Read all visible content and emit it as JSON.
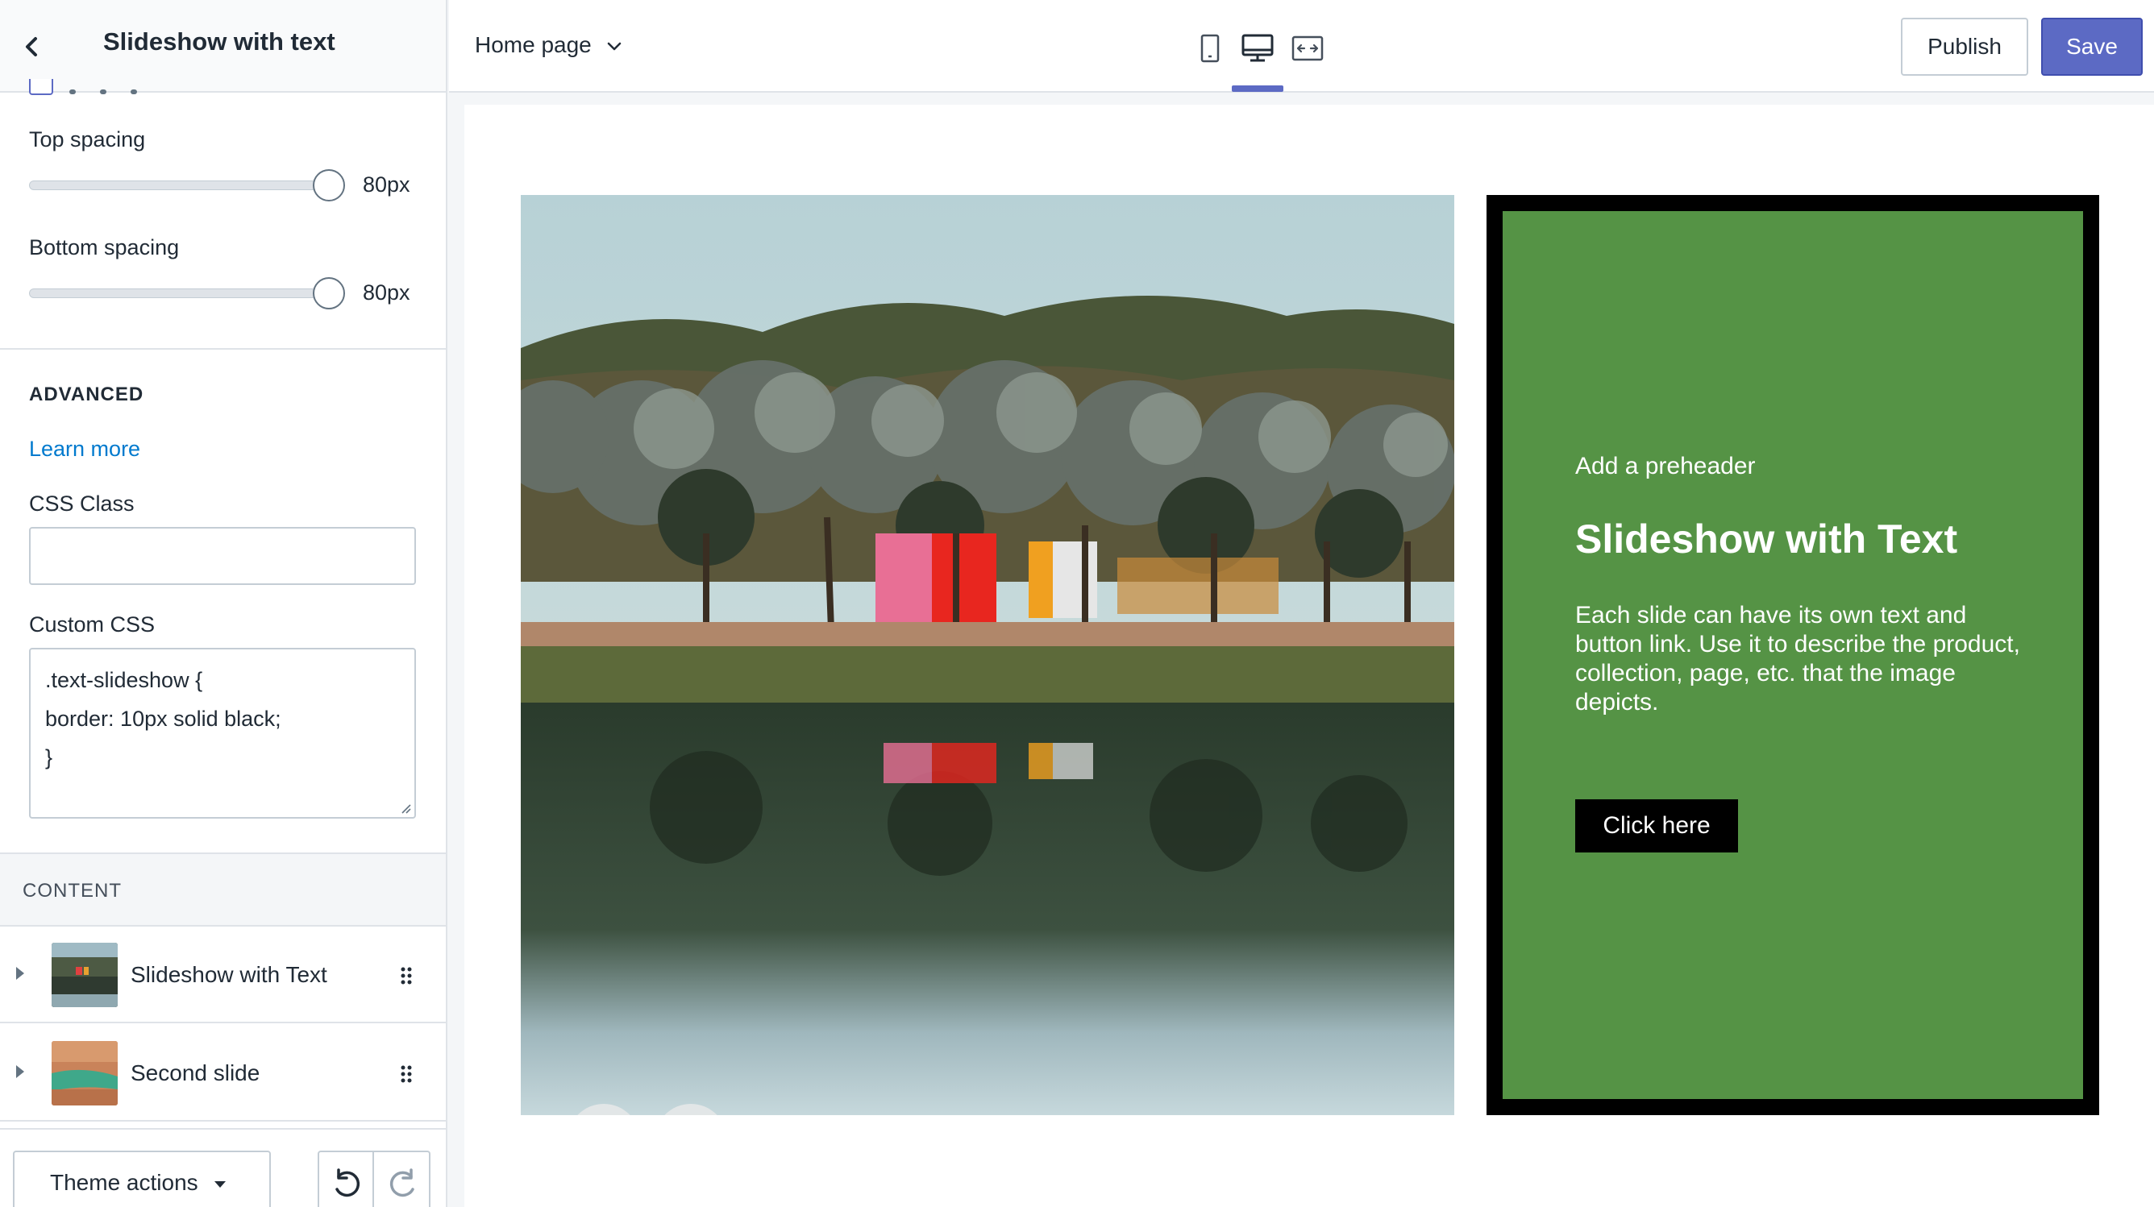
{
  "sidebar": {
    "title": "Slideshow with text",
    "top_spacing": {
      "label": "Top spacing",
      "value": "80px",
      "level": 100
    },
    "bottom_spacing": {
      "label": "Bottom spacing",
      "value": "80px",
      "level": 100
    },
    "advanced": {
      "heading": "ADVANCED",
      "learn_more": "Learn more",
      "css_class_label": "CSS Class",
      "css_class_value": "",
      "custom_css_label": "Custom CSS",
      "custom_css_lines": [
        ".text-slideshow {",
        "border: 10px solid black;",
        "}"
      ]
    },
    "content": {
      "heading": "CONTENT",
      "items": [
        {
          "label": "Slideshow with Text"
        },
        {
          "label": "Second slide"
        }
      ]
    },
    "footer": {
      "theme_actions": "Theme actions"
    }
  },
  "topbar": {
    "page": "Home page",
    "devices": [
      "mobile-icon",
      "desktop-icon",
      "fullwidth-icon"
    ],
    "active_device": "desktop-icon",
    "publish": "Publish",
    "save": "Save"
  },
  "preview": {
    "preheader": "Add a preheader",
    "heading": "Slideshow with Text",
    "body": "Each slide can have its own text and button link. Use it to describe the product, collection, page, etc. that the image depicts.",
    "button": "Click here"
  },
  "colors": {
    "accent": "#5c6ac4",
    "link": "#007ace",
    "panel_green": "#559345",
    "panel_border": "#000000"
  }
}
